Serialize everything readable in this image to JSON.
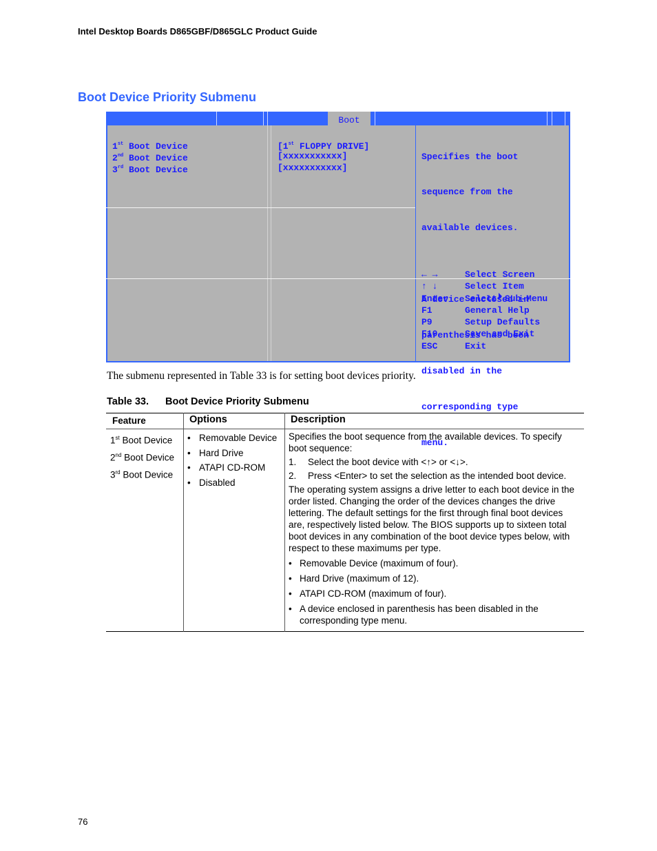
{
  "running_header": "Intel Desktop Boards D865GBF/D865GLC Product Guide",
  "section_title": "Boot Device Priority Submenu",
  "bios_screen": {
    "active_tab": "Boot",
    "colors": {
      "bar": "#3366ff",
      "background": "#b3b3b3",
      "text": "#1a1aff"
    },
    "items": [
      {
        "ordinal": "1",
        "suffix": "st",
        "label": "Boot Device",
        "value_prefix": "[1",
        "value_suffix": "st",
        "value_rest": " FLOPPY DRIVE]"
      },
      {
        "ordinal": "2",
        "suffix": "nd",
        "label": "Boot Device",
        "value": "[xxxxxxxxxxx]"
      },
      {
        "ordinal": "3",
        "suffix": "rd",
        "label": "Boot Device",
        "value": "[xxxxxxxxxxx]"
      }
    ],
    "help_text": [
      "Specifies the boot",
      "sequence from the",
      "available devices.",
      "",
      "A device enclosed in",
      "parenthesis has been",
      "disabled in the",
      "corresponding type",
      "menu."
    ],
    "key_legend": [
      {
        "key": "← →",
        "action": "Select Screen"
      },
      {
        "key": "↑ ↓",
        "action": "Select Item"
      },
      {
        "key": "Enter",
        "action_prefix": "Select",
        "action_suffix": "Sub-Menu",
        "icon": "right-triangle-icon"
      },
      {
        "key": "F1",
        "action": "General Help"
      },
      {
        "key": "P9",
        "action": "Setup Defaults"
      },
      {
        "key": "F10",
        "action": "Save and Exit"
      },
      {
        "key": "ESC",
        "action": "Exit"
      }
    ]
  },
  "body_text": "The submenu represented in Table 33 is for setting boot devices priority.",
  "table": {
    "caption_number": "Table 33.",
    "caption_title": "Boot Device Priority Submenu",
    "headers": {
      "feature": "Feature",
      "options": "Options",
      "description": "Description"
    },
    "features": [
      {
        "ordinal": "1",
        "suffix": "st",
        "label": " Boot Device"
      },
      {
        "ordinal": "2",
        "suffix": "nd",
        "label": " Boot Device"
      },
      {
        "ordinal": "3",
        "suffix": "rd",
        "label": " Boot Device"
      }
    ],
    "options": [
      "Removable Device",
      "Hard Drive",
      "ATAPI CD-ROM",
      "Disabled"
    ],
    "description": {
      "intro": "Specifies the boot sequence from the available devices.  To specify boot sequence:",
      "steps": [
        {
          "n": "1.",
          "text": "Select the boot device with <↑> or <↓>."
        },
        {
          "n": "2.",
          "text": "Press <Enter> to set the selection as the intended boot device."
        }
      ],
      "paragraph": "The operating system assigns a drive letter to each boot device in the order listed.  Changing the order of the devices changes the drive lettering.  The default settings for the first through final boot devices are, respectively listed below.  The BIOS supports up to sixteen total boot devices in any combination of the boot device types below, with respect to these maximums per type.",
      "bullets": [
        "Removable Device (maximum of four).",
        "Hard Drive (maximum of 12).",
        "ATAPI CD-ROM (maximum of four).",
        "A device enclosed in parenthesis has been disabled in the corresponding type menu."
      ]
    }
  },
  "page_number": "76"
}
